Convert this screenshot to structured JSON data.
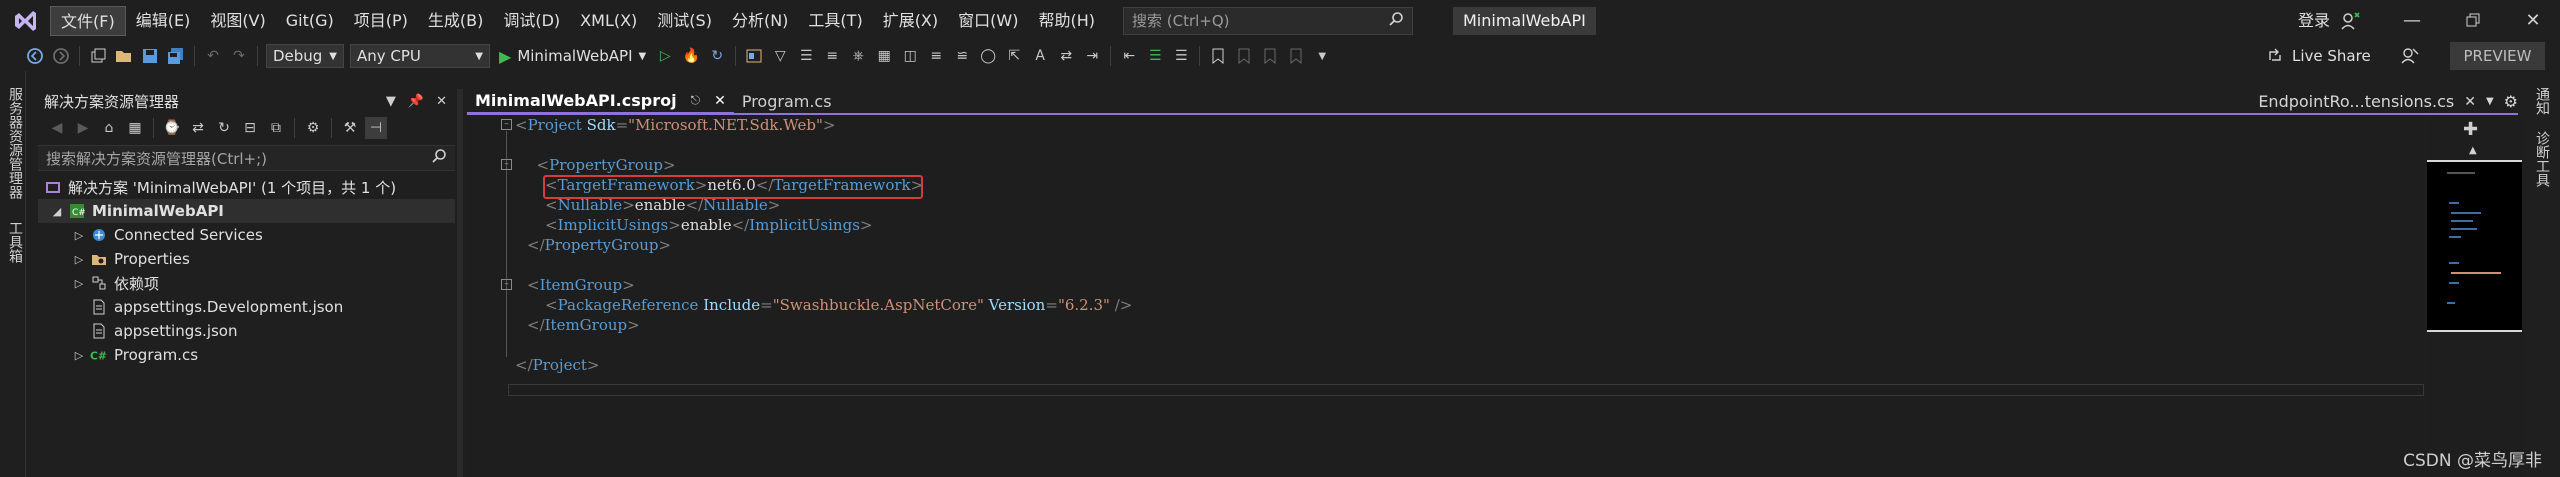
{
  "menu": [
    "文件(F)",
    "编辑(E)",
    "视图(V)",
    "Git(G)",
    "项目(P)",
    "生成(B)",
    "调试(D)",
    "XML(X)",
    "测试(S)",
    "分析(N)",
    "工具(T)",
    "扩展(X)",
    "窗口(W)",
    "帮助(H)"
  ],
  "search": {
    "placeholder": "搜索 (Ctrl+Q)"
  },
  "solution_badge": "MinimalWebAPI",
  "signin": "登录",
  "toolbar": {
    "config": "Debug",
    "platform": "Any CPU",
    "run_target": "MinimalWebAPI",
    "live_share": "Live Share",
    "preview": "PREVIEW"
  },
  "left_strip": {
    "server_explorer": "服务器资源管理器",
    "toolbox": "工具箱"
  },
  "right_strip": {
    "notifications": "通知",
    "diagnostics": "诊断工具"
  },
  "solution_explorer": {
    "title": "解决方案资源管理器",
    "search_placeholder": "搜索解决方案资源管理器(Ctrl+;)",
    "solution_line": "解决方案 'MinimalWebAPI' (1 个项目，共 1 个)",
    "project": "MinimalWebAPI",
    "items": [
      "Connected Services",
      "Properties",
      "依赖项",
      "appsettings.Development.json",
      "appsettings.json",
      "Program.cs"
    ]
  },
  "tabs": {
    "active": "MinimalWebAPI.csproj",
    "inactive": "Program.cs",
    "right": "EndpointRo...tensions.cs"
  },
  "code": {
    "l1_tag": "Project",
    "l1_attr": "Sdk",
    "l1_val": "\"Microsoft.NET.Sdk.Web\"",
    "pg_open": "PropertyGroup",
    "tf_tag": "TargetFramework",
    "tf_val": "net6.0",
    "nullable_tag": "Nullable",
    "nullable_val": "enable",
    "iu_tag": "ImplicitUsings",
    "iu_val": "enable",
    "pg_close": "PropertyGroup",
    "ig_open": "ItemGroup",
    "pr_tag": "PackageReference",
    "pr_attr1": "Include",
    "pr_val1": "\"Swashbuckle.AspNetCore\"",
    "pr_attr2": "Version",
    "pr_val2": "\"6.2.3\"",
    "ig_close": "ItemGroup",
    "proj_close": "Project"
  },
  "watermark": "CSDN @菜鸟厚非",
  "colors": {
    "accent": "#8f73d6",
    "highlight": "#d93a3a",
    "tag": "#569cd6",
    "attr": "#9cdcfe",
    "string": "#ce9178"
  }
}
